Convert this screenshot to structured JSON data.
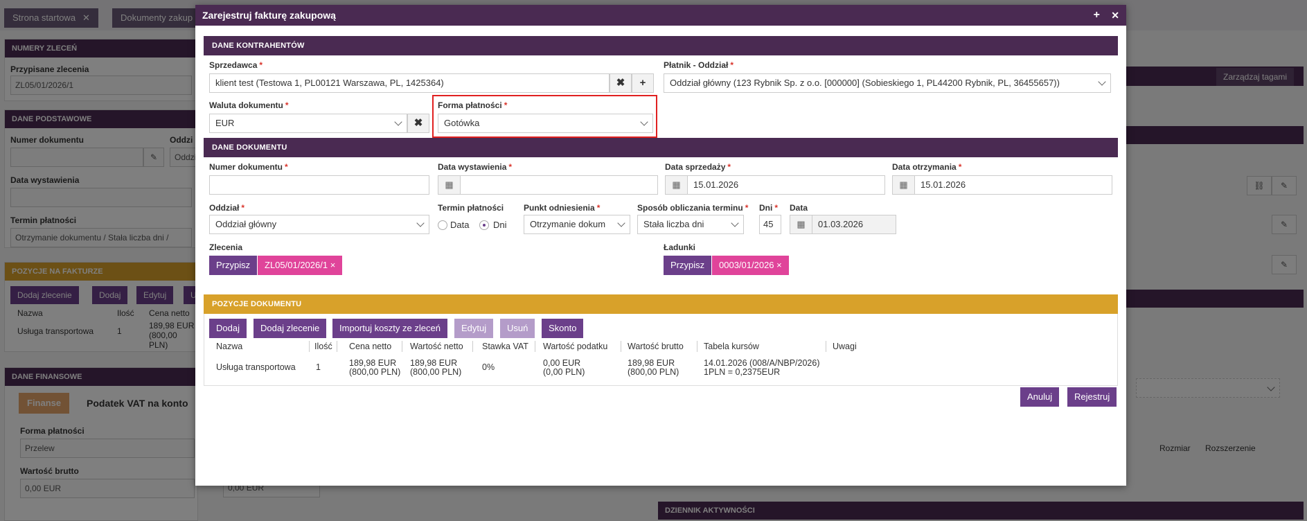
{
  "bg": {
    "tabs": [
      {
        "label": "Strona startowa"
      },
      {
        "label": "Dokumenty zakup"
      }
    ],
    "numery_zlecen": {
      "head": "NUMERY ZLECEŃ",
      "label": "Przypisane zlecenia",
      "value": "ZL05/01/2026/1"
    },
    "dane_podstawowe": {
      "head": "DANE PODSTAWOWE",
      "numer_label": "Numer dokumentu",
      "oddz_label": "Oddzi",
      "oddz_value": "Oddzi",
      "data_label": "Data wystawienia",
      "termin_label": "Termin płatności",
      "termin_value": "Otrzymanie dokumentu / Stała liczba dni /"
    },
    "pozycje": {
      "head": "POZYCJE NA FAKTURZE",
      "buttons": [
        "Dodaj zlecenie",
        "Dodaj",
        "Edytuj",
        "U"
      ],
      "col_nazwa": "Nazwa",
      "col_ilosc": "Ilość",
      "col_cena": "Cena netto",
      "row_nazwa": "Usługa transportowa",
      "row_ilosc": "1",
      "row_cena1": "189,98 EUR",
      "row_cena2": "(800,00 PLN)"
    },
    "finansowe": {
      "head": "DANE FINANSOWE",
      "tab1": "Finanse",
      "tab2": "Podatek VAT na konto",
      "forma_label": "Forma płatności",
      "forma_value": "Przelew",
      "brutto_label": "Wartość brutto",
      "brutto_value": "0,00 EUR",
      "brutto_value2": "0,00 EUR"
    },
    "right": {
      "tags_btn": "Zarządzaj tagami",
      "rozmiar": "Rozmiar",
      "rozszerzenie": "Rozszerzenie",
      "dziennik": "DZIENNIK AKTYWNOŚCI"
    }
  },
  "modal": {
    "title": "Zarejestruj fakturę zakupową",
    "sections": {
      "kontrahenci": "DANE KONTRAHENTÓW",
      "dokument": "DANE DOKUMENTU",
      "pozycje": "POZYCJE DOKUMENTU"
    },
    "sprzedawca": {
      "label": "Sprzedawca",
      "value": "klient test (Testowa 1, PL00121 Warszawa, PL, 1425364)"
    },
    "platnik": {
      "label": "Płatnik - Oddział",
      "value": "Oddział główny (123 Rybnik Sp. z o.o. [000000] (Sobieskiego 1, PL44200 Rybnik, PL, 36455657))"
    },
    "waluta": {
      "label": "Waluta dokumentu",
      "value": "EUR"
    },
    "forma": {
      "label": "Forma płatności",
      "value": "Gotówka"
    },
    "numer": {
      "label": "Numer dokumentu",
      "value": ""
    },
    "data_wystawienia": {
      "label": "Data wystawienia",
      "value": ""
    },
    "data_sprzedazy": {
      "label": "Data sprzedaży",
      "value": "15.01.2026"
    },
    "data_otrzymania": {
      "label": "Data otrzymania",
      "value": "15.01.2026"
    },
    "oddzial": {
      "label": "Oddział",
      "value": "Oddział główny"
    },
    "termin": {
      "label": "Termin płatności",
      "opt_data": "Data",
      "opt_dni": "Dni",
      "selected": "Dni"
    },
    "punkt": {
      "label": "Punkt odniesienia",
      "value": "Otrzymanie dokum"
    },
    "sposob": {
      "label": "Sposób obliczania terminu",
      "value": "Stała liczba dni"
    },
    "dni": {
      "label": "Dni",
      "value": "45"
    },
    "data": {
      "label": "Data",
      "value": "01.03.2026"
    },
    "zlecenia": {
      "label": "Zlecenia",
      "button": "Przypisz",
      "tag": "ZL05/01/2026/1 ×"
    },
    "ladunki": {
      "label": "Ładunki",
      "button": "Przypisz",
      "tag": "0003/01/2026 ×"
    },
    "pos_buttons": {
      "dodaj": "Dodaj",
      "dodaj_zlecenie": "Dodaj zlecenie",
      "importuj": "Importuj koszty ze zleceń",
      "edytuj": "Edytuj",
      "usun": "Usuń",
      "skonto": "Skonto"
    },
    "table": {
      "headers": [
        "Nazwa",
        "Ilość",
        "Cena netto",
        "Wartość netto",
        "Stawka VAT",
        "Wartość podatku",
        "Wartość brutto",
        "Tabela kursów",
        "Uwagi"
      ],
      "row": {
        "nazwa": "Usługa transportowa",
        "ilosc": "1",
        "cena_netto": "189,98 EUR",
        "cena_netto_pln": "(800,00 PLN)",
        "wartosc_netto": "189,98 EUR",
        "wartosc_netto_pln": "(800,00 PLN)",
        "stawka": "0%",
        "podatek": "0,00 EUR",
        "podatek_pln": "(0,00 PLN)",
        "brutto": "189,98 EUR",
        "brutto_pln": "(800,00 PLN)",
        "kurs": "14.01.2026 (008/A/NBP/2026)",
        "kurs2": "1PLN = 0,2375EUR",
        "uwagi": ""
      }
    },
    "footer": {
      "anuluj": "Anuluj",
      "rejestruj": "Rejestruj"
    },
    "colors": {
      "header": "#4a2a52",
      "accent": "#6b3f8a",
      "gold": "#d8a12a",
      "tag": "#e0449a",
      "required": "#d9342b",
      "highlight": "#e02020"
    }
  }
}
